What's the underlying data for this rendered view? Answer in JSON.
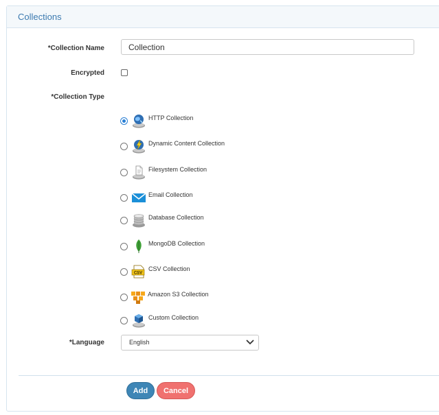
{
  "panel": {
    "title": "Collections"
  },
  "form": {
    "collection_name": {
      "label": "*Collection Name",
      "value": "Collection"
    },
    "encrypted": {
      "label": "Encrypted",
      "checked": false
    },
    "collection_type": {
      "label": "*Collection Type",
      "selected": "HTTP Collection",
      "options": [
        {
          "label": "HTTP Collection",
          "icon": "http-globe-icon"
        },
        {
          "label": "Dynamic Content Collection",
          "icon": "dynamic-content-icon"
        },
        {
          "label": "Filesystem Collection",
          "icon": "filesystem-icon"
        },
        {
          "label": "Email Collection",
          "icon": "email-envelope-icon"
        },
        {
          "label": "Database Collection",
          "icon": "database-icon"
        },
        {
          "label": "MongoDB Collection",
          "icon": "mongodb-leaf-icon"
        },
        {
          "label": "CSV Collection",
          "icon": "csv-file-icon"
        },
        {
          "label": "Amazon S3 Collection",
          "icon": "amazon-s3-icon"
        },
        {
          "label": "Custom Collection",
          "icon": "custom-cube-icon"
        }
      ]
    },
    "language": {
      "label": "*Language",
      "value": "English"
    }
  },
  "actions": {
    "add_label": "Add",
    "cancel_label": "Cancel"
  },
  "colors": {
    "primary": "#3e86b6",
    "danger": "#f0716f",
    "heading_text": "#3c7ab0",
    "radio_accent": "#2a7fd4"
  }
}
